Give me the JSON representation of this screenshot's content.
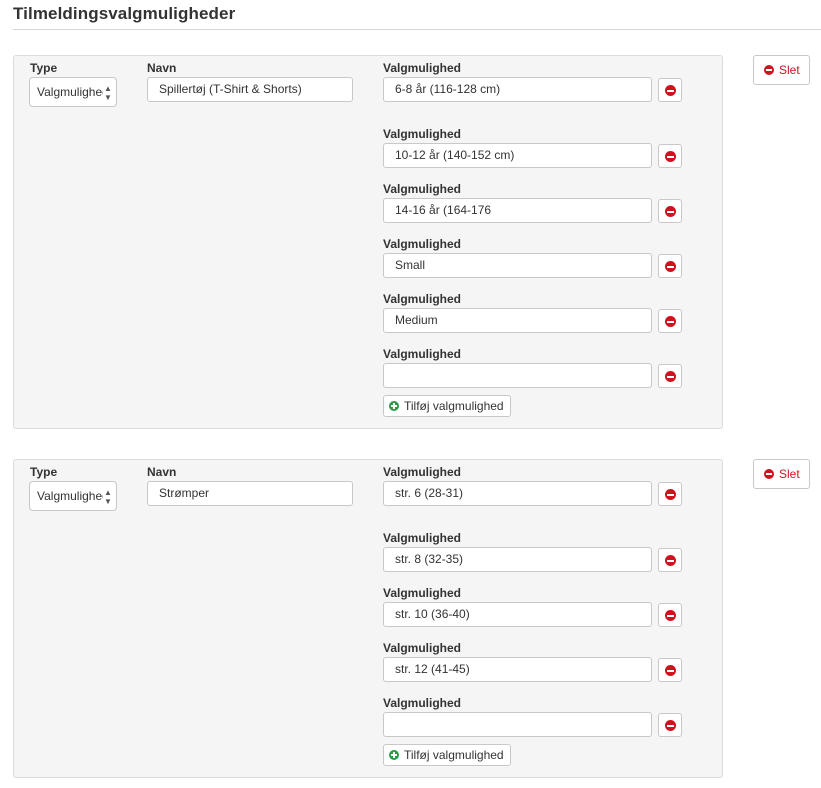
{
  "section": {
    "title": "Tilmeldingsvalgmuligheder"
  },
  "labels": {
    "type": "Type",
    "name": "Navn",
    "option": "Valgmulighed"
  },
  "groups": [
    {
      "type_value": "Valgmulighed",
      "name_value": "Spillertøj (T-Shirt & Shorts)",
      "options": [
        "6-8 år (116-128 cm)",
        "10-12 år (140-152 cm)",
        "14-16 år (164-176",
        "Small",
        "Medium",
        ""
      ],
      "add_label": "Tilføj valgmulighed",
      "delete_label": "Slet"
    },
    {
      "type_value": "Valgmulighed",
      "name_value": "Strømper",
      "options": [
        "str. 6 (28-31)",
        "str. 8 (32-35)",
        "str. 10 (36-40)",
        "str. 12 (41-45)",
        ""
      ],
      "add_label": "Tilføj valgmulighed",
      "delete_label": "Slet"
    }
  ],
  "colors": {
    "danger": "#d0121f",
    "success": "#2e9a45",
    "panel": "#f5f5f5"
  },
  "icons": {
    "remove": "minus-circle-icon",
    "add": "plus-circle-icon",
    "select": "sort-arrows-icon"
  }
}
